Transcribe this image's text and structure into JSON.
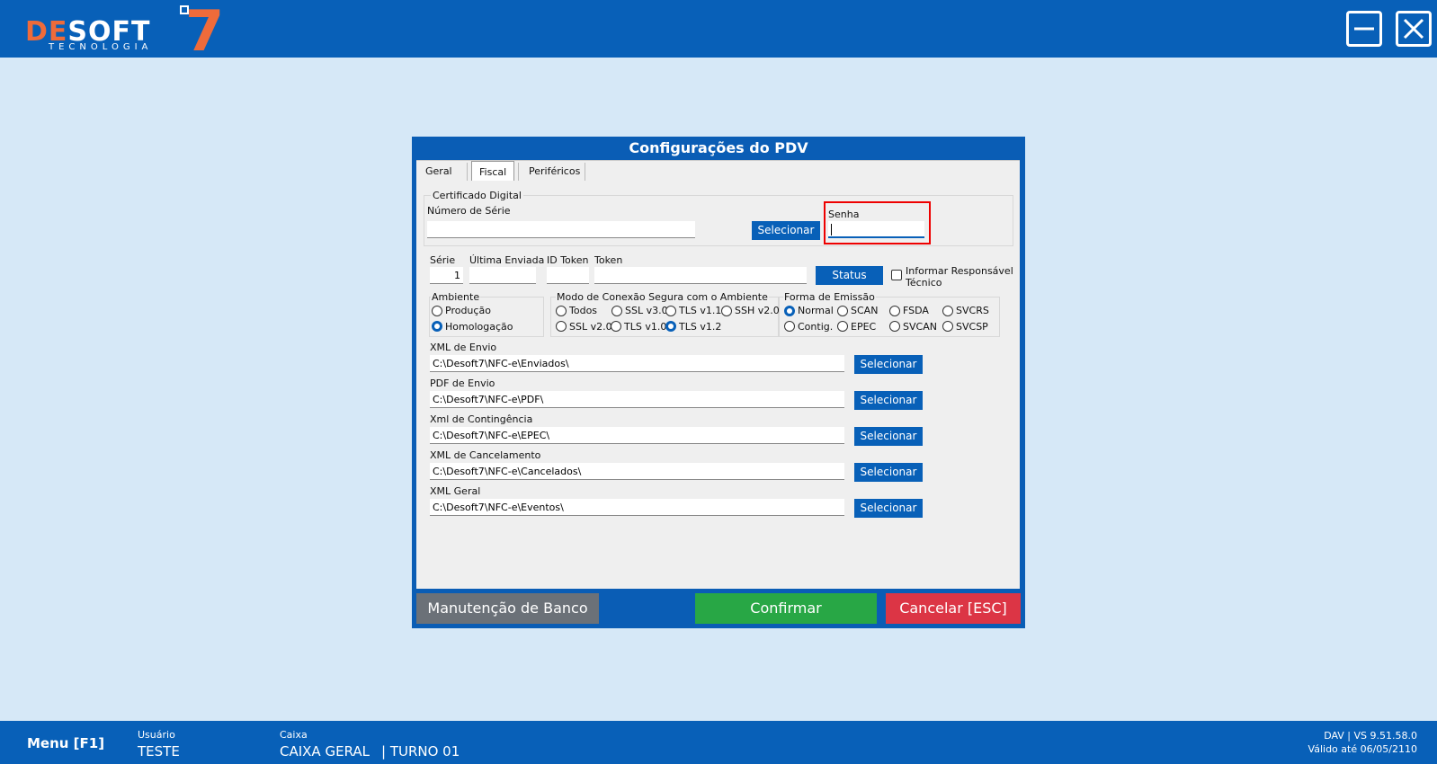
{
  "app": {
    "logo_brand_de": "DE",
    "logo_brand_soft": "SOFT",
    "logo_seven": "7",
    "logo_sub": "TECNOLOGIA",
    "colors": {
      "primary": "#0860b8",
      "background": "#d6e8f7",
      "accent": "#ef6b3a",
      "confirm": "#28a745",
      "cancel": "#dc3545",
      "maintenance": "#6c757d"
    }
  },
  "dialog": {
    "title": "Configurações do PDV",
    "tabs": [
      {
        "label": "Geral",
        "active": false
      },
      {
        "label": "Fiscal",
        "active": true
      },
      {
        "label": "Periféricos",
        "active": false
      }
    ],
    "certificado": {
      "group_label": "Certificado Digital",
      "numero_serie_label": "Número de Série",
      "numero_serie_value": "",
      "selecionar_label": "Selecionar",
      "senha_label": "Senha",
      "senha_value": ""
    },
    "serie": {
      "serie_label": "Série",
      "serie_value": "1",
      "ultima_label": "Última Enviada",
      "ultima_value": "",
      "id_token_label": "ID Token",
      "id_token_value": "",
      "token_label": "Token",
      "token_value": "",
      "status_label": "Status",
      "informar_label_1": "Informar Responsável",
      "informar_label_2": "Técnico",
      "informar_checked": false
    },
    "ambiente": {
      "label": "Ambiente",
      "options": [
        {
          "label": "Produção",
          "selected": false
        },
        {
          "label": "Homologação",
          "selected": true
        }
      ]
    },
    "conexao": {
      "label": "Modo de Conexão Segura com o Ambiente",
      "options": [
        {
          "label": "Todos",
          "selected": false
        },
        {
          "label": "SSL v3.0",
          "selected": false
        },
        {
          "label": "TLS v1.1",
          "selected": false
        },
        {
          "label": "SSH v2.0",
          "selected": false
        },
        {
          "label": "SSL v2.0",
          "selected": false
        },
        {
          "label": "TLS v1.0",
          "selected": false
        },
        {
          "label": "TLS v1.2",
          "selected": true
        }
      ]
    },
    "emissao": {
      "label": "Forma de Emissão",
      "options": [
        {
          "label": "Normal",
          "selected": true
        },
        {
          "label": "SCAN",
          "selected": false
        },
        {
          "label": "FSDA",
          "selected": false
        },
        {
          "label": "SVCRS",
          "selected": false
        },
        {
          "label": "Contig.",
          "selected": false
        },
        {
          "label": "EPEC",
          "selected": false
        },
        {
          "label": "SVCAN",
          "selected": false
        },
        {
          "label": "SVCSP",
          "selected": false
        }
      ]
    },
    "paths": [
      {
        "label": "XML de Envio",
        "value": "C:\\Desoft7\\NFC-e\\Enviados\\",
        "button": "Selecionar"
      },
      {
        "label": "PDF de Envio",
        "value": "C:\\Desoft7\\NFC-e\\PDF\\",
        "button": "Selecionar"
      },
      {
        "label": "Xml de Contingência",
        "value": "C:\\Desoft7\\NFC-e\\EPEC\\",
        "button": "Selecionar"
      },
      {
        "label": "XML de Cancelamento",
        "value": "C:\\Desoft7\\NFC-e\\Cancelados\\",
        "button": "Selecionar"
      },
      {
        "label": "XML Geral",
        "value": "C:\\Desoft7\\NFC-e\\Eventos\\",
        "button": "Selecionar"
      }
    ],
    "buttons": {
      "manutencao": "Manutenção de Banco",
      "confirmar": "Confirmar",
      "cancelar": "Cancelar [ESC]"
    }
  },
  "statusbar": {
    "menu": "Menu [F1]",
    "usuario_label": "Usuário",
    "usuario_value": "TESTE",
    "caixa_label": "Caixa",
    "caixa_value": "CAIXA GERAL",
    "turno_value": "| TURNO 01",
    "version": "DAV | VS 9.51.58.0",
    "validade": "Válido até 06/05/2110"
  }
}
